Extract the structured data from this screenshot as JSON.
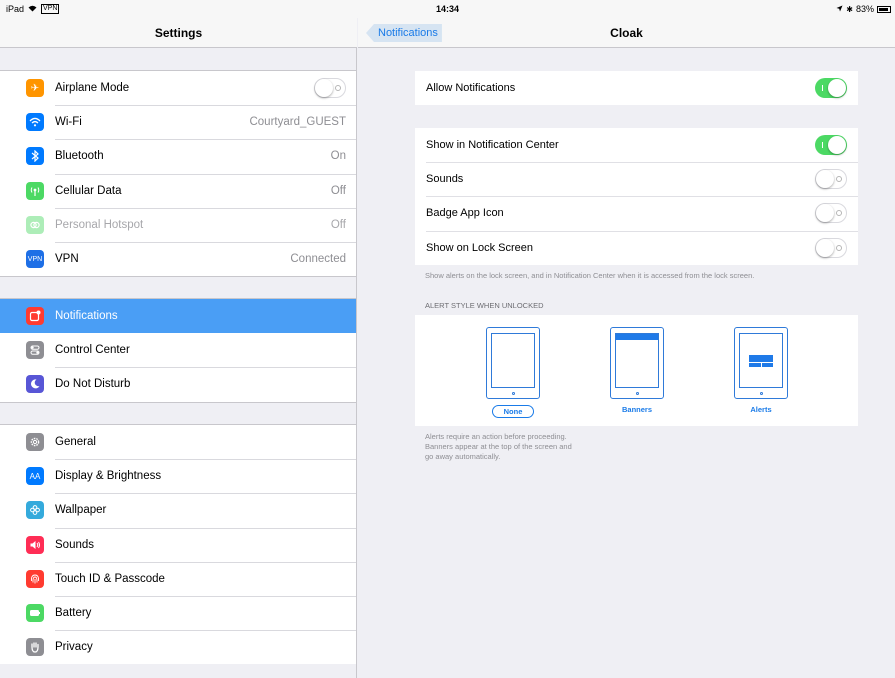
{
  "status_bar": {
    "device": "iPad",
    "vpn_badge": "VPN",
    "time": "14:34",
    "battery": "83%"
  },
  "sidebar": {
    "title": "Settings",
    "groups": [
      [
        {
          "label": "Airplane Mode",
          "value": "",
          "icon": "airplane-icon",
          "color": "#ff9500",
          "toggle": "off"
        },
        {
          "label": "Wi-Fi",
          "value": "Courtyard_GUEST",
          "icon": "wifi-icon",
          "color": "#007aff"
        },
        {
          "label": "Bluetooth",
          "value": "On",
          "icon": "bluetooth-icon",
          "color": "#007aff"
        },
        {
          "label": "Cellular Data",
          "value": "Off",
          "icon": "cellular-icon",
          "color": "#4cd964"
        },
        {
          "label": "Personal Hotspot",
          "value": "Off",
          "icon": "hotspot-icon",
          "color": "#4cd964",
          "dim": true
        },
        {
          "label": "VPN",
          "value": "Connected",
          "icon": "vpn-icon",
          "color": "#1e6fe6"
        }
      ],
      [
        {
          "label": "Notifications",
          "value": "",
          "icon": "notifications-icon",
          "color": "#ff3b30",
          "selected": true
        },
        {
          "label": "Control Center",
          "value": "",
          "icon": "control-center-icon",
          "color": "#8e8e93"
        },
        {
          "label": "Do Not Disturb",
          "value": "",
          "icon": "moon-icon",
          "color": "#5856d6"
        }
      ],
      [
        {
          "label": "General",
          "value": "",
          "icon": "gear-icon",
          "color": "#8e8e93"
        },
        {
          "label": "Display & Brightness",
          "value": "",
          "icon": "display-icon",
          "color": "#007aff"
        },
        {
          "label": "Wallpaper",
          "value": "",
          "icon": "wallpaper-icon",
          "color": "#34aadc"
        },
        {
          "label": "Sounds",
          "value": "",
          "icon": "speaker-icon",
          "color": "#ff2d55"
        },
        {
          "label": "Touch ID & Passcode",
          "value": "",
          "icon": "fingerprint-icon",
          "color": "#ff3b30"
        },
        {
          "label": "Battery",
          "value": "",
          "icon": "battery-icon",
          "color": "#4cd964"
        },
        {
          "label": "Privacy",
          "value": "",
          "icon": "hand-icon",
          "color": "#8e8e93"
        }
      ]
    ]
  },
  "detail": {
    "back_label": "Notifications",
    "title": "Cloak",
    "allow_notifications": {
      "label": "Allow Notifications",
      "state": "on"
    },
    "options": [
      {
        "label": "Show in Notification Center",
        "state": "on"
      },
      {
        "label": "Sounds",
        "state": "off"
      },
      {
        "label": "Badge App Icon",
        "state": "off"
      },
      {
        "label": "Show on Lock Screen",
        "state": "off"
      }
    ],
    "lock_screen_note": "Show alerts on the lock screen, and in Notification Center when it is accessed from the lock screen.",
    "alert_style_title": "ALERT STYLE WHEN UNLOCKED",
    "alert_styles": [
      {
        "label": "None",
        "selected": true
      },
      {
        "label": "Banners",
        "selected": false
      },
      {
        "label": "Alerts",
        "selected": false
      }
    ],
    "alert_style_note_lines": [
      "Alerts require an action before proceeding.",
      "Banners appear at the top of the screen and",
      "go away automatically."
    ]
  }
}
